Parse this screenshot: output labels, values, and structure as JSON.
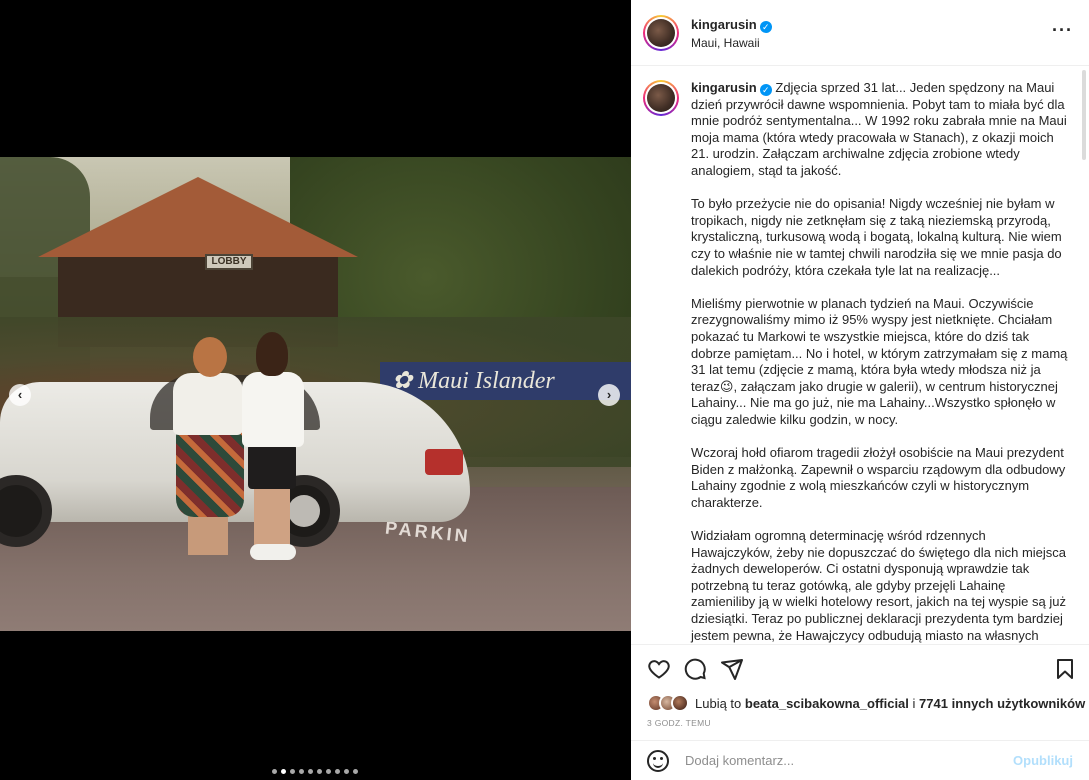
{
  "post": {
    "username": "kingarusin",
    "location": "Maui, Hawaii",
    "verified_icon": "✓",
    "more_label": "···"
  },
  "photo": {
    "lobby_sign": "LOBBY",
    "hotel_sign": "✿ Maui Islander",
    "ground_text": "PARKIN"
  },
  "carousel": {
    "prev_label": "‹",
    "next_label": "›",
    "dot_count": 10,
    "active_index": 1
  },
  "caption": {
    "paragraphs": [
      "Zdjęcia sprzed 31 lat... Jeden spędzony na Maui dzień przywrócił dawne wspomnienia. Pobyt tam to miała być dla mnie podróż sentymentalna... W 1992 roku zabrała mnie na Maui moja mama (która wtedy pracowała w Stanach), z okazji moich 21. urodzin. Załączam archiwalne zdjęcia zrobione wtedy analogiem, stąd ta jakość.",
      "To było przeżycie nie do opisania! Nigdy wcześniej nie byłam w tropikach, nigdy nie zetknęłam się z taką nieziemską przyrodą, krystaliczną, turkusową wodą i bogatą, lokalną kulturą. Nie wiem czy to właśnie nie w tamtej chwili narodziła się we mnie pasja do dalekich podróży, która czekała tyle lat na realizację...",
      "Mieliśmy pierwotnie w planach tydzień na Maui. Oczywiście zrezygnowaliśmy mimo iż 95% wyspy jest nietknięte. Chciałam pokazać tu Markowi te wszystkie miejsca, które do dziś tak dobrze pamiętam... No i hotel, w którym zatrzymałam się z mamą 31 lat temu (zdjęcie z mamą, która była wtedy młodsza niż ja teraz😉, załączam jako drugie w galerii), w centrum historycznej Lahainy... Nie ma go już, nie ma Lahainy...Wszystko spłonęło w ciągu zaledwie kilku godzin, w nocy.",
      "Wczoraj hołd ofiarom tragedii złożył osobiście na Maui prezydent Biden z małżonką. Zapewnił o wsparciu rządowym dla odbudowy Lahainy zgodnie z wolą mieszkańców czyli w historycznym charakterze.",
      "Widziałam ogromną determinację wśród rdzennych Hawajczyków, żeby nie dopuszczać do świętego dla nich miejsca żadnych deweloperów. Ci ostatni dysponują wprawdzie tak potrzebną tu teraz gotówką, ale gdyby przejęli Lahainę zamieniliby ją w wielki hotelowy resort, jakich na tej wyspie są już dziesiątki. Teraz po publicznej deklaracji prezydenta tym bardziej jestem pewna, że Hawajczycy odbudują miasto na własnych zasadach, że stanie się"
    ]
  },
  "likes": {
    "prefix": "Lubią to",
    "user": "beata_scibakowna_official",
    "middle": "i",
    "count": "7741 innych użytkowników"
  },
  "time_ago": "3 GODZ. TEMU",
  "comment": {
    "placeholder": "Dodaj komentarz...",
    "publish_label": "Opublikuj"
  },
  "icons": [
    "heart-icon",
    "comment-icon",
    "share-icon",
    "bookmark-icon",
    "emoji-icon",
    "more-icon"
  ]
}
